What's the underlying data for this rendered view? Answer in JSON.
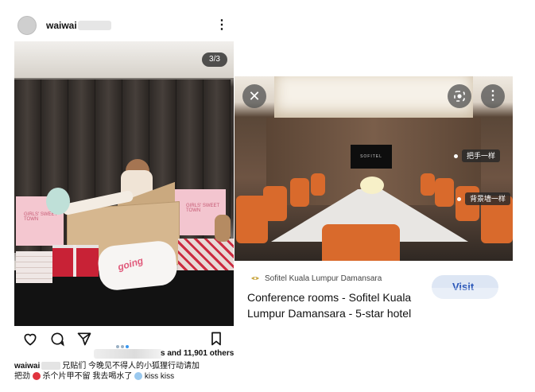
{
  "instagram": {
    "username": "waiwai",
    "photo_counter": "3/3",
    "box_text_left": "GIRLS' SWEET TOWN",
    "box_text_right": "GIRLS' SWEET TOWN",
    "pillow_text": "going",
    "likes_suffix": "s and 11,901 others",
    "caption_user": "waiwai",
    "caption_line1": "兄贴们 今晚见不得人的小狐狸行动请加",
    "caption_line2_a": "把劲",
    "caption_line2_b": "杀个片甲不留  我去喝水了",
    "caption_line2_c": "kiss kiss",
    "icons": [
      "heart-icon",
      "comment-icon",
      "share-icon",
      "bookmark-icon",
      "more-icon"
    ]
  },
  "maps": {
    "tv_text": "SOFITEL",
    "tag_1": "把手一样",
    "tag_2": "背景墙一样",
    "place_subtitle": "Sofitel Kuala Lumpur Damansara",
    "place_title": "Conference rooms - Sofitel Kuala Lumpur Damansara - 5-star hotel",
    "visit_label": "Visit",
    "icons": [
      "close-icon",
      "lens-icon",
      "more-icon",
      "hotel-icon"
    ]
  },
  "colors": {
    "instagram_blue": "#3897f0",
    "maps_button_bg": "#dde6f4",
    "maps_button_text": "#2a56b8",
    "chair_orange": "#d96a2c"
  }
}
